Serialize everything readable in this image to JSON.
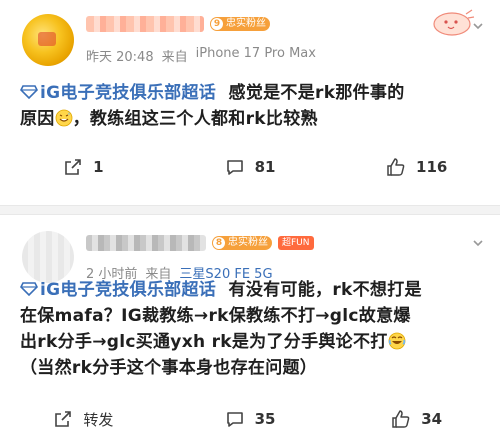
{
  "posts": [
    {
      "time": "昨天 20:48",
      "source_prefix": "来自",
      "device": "iPhone 17 Pro Max",
      "badge_fan": "忠实粉丝",
      "badge_fan_level": "9",
      "topic": "iG电子竞技俱乐部超话",
      "text_line1_after_topic": "感觉是不是rk那件事的",
      "text_line2": "原因",
      "text_line2_after_emoji": "，教练组这三个人都和rk比较熟",
      "actions": {
        "share_count": "1",
        "comment_count": "81",
        "like_count": "116"
      }
    },
    {
      "time": "2 小时前",
      "source_prefix": "来自",
      "device": "三星S20 FE 5G",
      "badge_fan": "忠实粉丝",
      "badge_fan_level": "8",
      "badge_super": "超FUN",
      "topic": "iG电子竞技俱乐部超话",
      "text_line1_after_topic": "有没有可能，rk不想打是",
      "text_line2": "在保mafa？IG裁教练→rk保教练不打→glc故意爆",
      "text_line3": "出rk分手→glc买通yxh rk是为了分手舆论不打",
      "text_line4": "（当然rk分手这个事本身也存在问题）",
      "actions": {
        "share_label": "转发",
        "comment_count": "35",
        "like_count": "34"
      }
    }
  ],
  "icons": {
    "share": "share-icon",
    "comment": "comment-icon",
    "like": "like-icon",
    "topic": "supertopic-diamond-icon",
    "chevron": "chevron-down-icon"
  },
  "colors": {
    "topic_blue": "#3a6fb8",
    "badge_orange": "#f6a03b",
    "meta_gray": "#8a8a8a"
  }
}
